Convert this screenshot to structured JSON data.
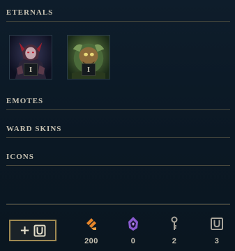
{
  "sections": {
    "eternals": {
      "title": "ETERNALS"
    },
    "emotes": {
      "title": "EMOTES"
    },
    "ward_skins": {
      "title": "WARD SKINS"
    },
    "icons": {
      "title": "ICONS"
    }
  },
  "eternals": [
    {
      "level": "I",
      "icon": "dark-champion-portrait"
    },
    {
      "level": "I",
      "icon": "green-champion-portrait"
    }
  ],
  "footer": {
    "add_button": {
      "label": "+",
      "icon": "chest-icon"
    },
    "currencies": [
      {
        "icon": "orange-essence-icon",
        "value": "200",
        "color": "#e8862a"
      },
      {
        "icon": "mythic-essence-icon",
        "value": "0",
        "color": "#9a6ad8"
      },
      {
        "icon": "key-icon",
        "value": "2",
        "color": "#a8a49a"
      },
      {
        "icon": "chest-icon",
        "value": "3",
        "color": "#a8a49a"
      }
    ]
  }
}
